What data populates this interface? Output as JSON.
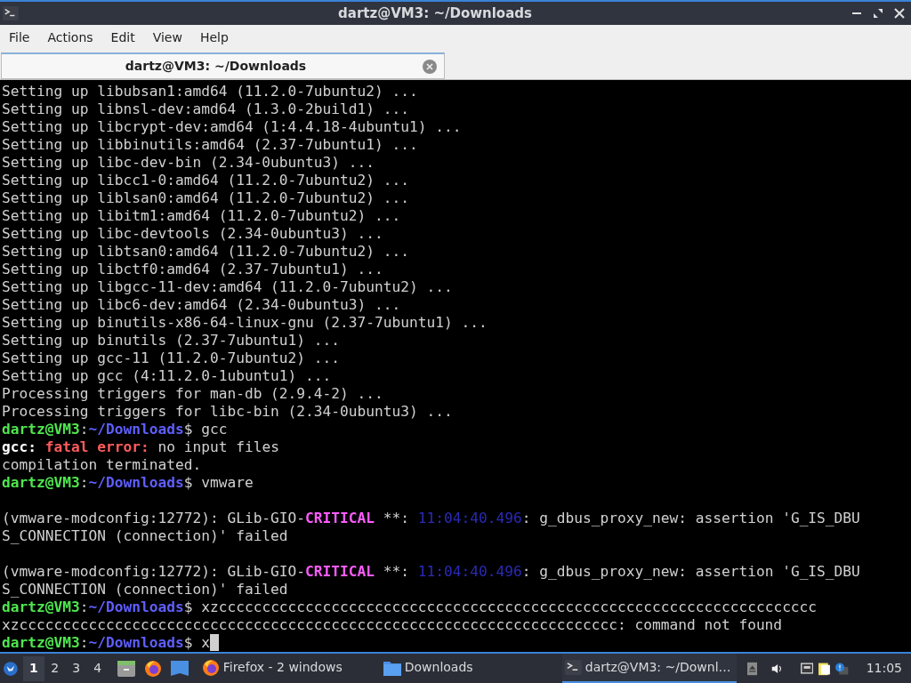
{
  "window": {
    "title": "dartz@VM3: ~/Downloads"
  },
  "menu": [
    "File",
    "Actions",
    "Edit",
    "View",
    "Help"
  ],
  "tabs": [
    {
      "label": "dartz@VM3: ~/Downloads",
      "selected": true
    }
  ],
  "terminal": {
    "lines": [
      {
        "kind": "text",
        "segments": [
          {
            "kind": "plain",
            "text": "Setting up libubsan1:amd64 (11.2.0-7ubuntu2) ..."
          }
        ]
      },
      {
        "kind": "text",
        "segments": [
          {
            "kind": "plain",
            "text": "Setting up libnsl-dev:amd64 (1.3.0-2build1) ..."
          }
        ]
      },
      {
        "kind": "text",
        "segments": [
          {
            "kind": "plain",
            "text": "Setting up libcrypt-dev:amd64 (1:4.4.18-4ubuntu1) ..."
          }
        ]
      },
      {
        "kind": "text",
        "segments": [
          {
            "kind": "plain",
            "text": "Setting up libbinutils:amd64 (2.37-7ubuntu1) ..."
          }
        ]
      },
      {
        "kind": "text",
        "segments": [
          {
            "kind": "plain",
            "text": "Setting up libc-dev-bin (2.34-0ubuntu3) ..."
          }
        ]
      },
      {
        "kind": "text",
        "segments": [
          {
            "kind": "plain",
            "text": "Setting up libcc1-0:amd64 (11.2.0-7ubuntu2) ..."
          }
        ]
      },
      {
        "kind": "text",
        "segments": [
          {
            "kind": "plain",
            "text": "Setting up liblsan0:amd64 (11.2.0-7ubuntu2) ..."
          }
        ]
      },
      {
        "kind": "text",
        "segments": [
          {
            "kind": "plain",
            "text": "Setting up libitm1:amd64 (11.2.0-7ubuntu2) ..."
          }
        ]
      },
      {
        "kind": "text",
        "segments": [
          {
            "kind": "plain",
            "text": "Setting up libc-devtools (2.34-0ubuntu3) ..."
          }
        ]
      },
      {
        "kind": "text",
        "segments": [
          {
            "kind": "plain",
            "text": "Setting up libtsan0:amd64 (11.2.0-7ubuntu2) ..."
          }
        ]
      },
      {
        "kind": "text",
        "segments": [
          {
            "kind": "plain",
            "text": "Setting up libctf0:amd64 (2.37-7ubuntu1) ..."
          }
        ]
      },
      {
        "kind": "text",
        "segments": [
          {
            "kind": "plain",
            "text": "Setting up libgcc-11-dev:amd64 (11.2.0-7ubuntu2) ..."
          }
        ]
      },
      {
        "kind": "text",
        "segments": [
          {
            "kind": "plain",
            "text": "Setting up libc6-dev:amd64 (2.34-0ubuntu3) ..."
          }
        ]
      },
      {
        "kind": "text",
        "segments": [
          {
            "kind": "plain",
            "text": "Setting up binutils-x86-64-linux-gnu (2.37-7ubuntu1) ..."
          }
        ]
      },
      {
        "kind": "text",
        "segments": [
          {
            "kind": "plain",
            "text": "Setting up binutils (2.37-7ubuntu1) ..."
          }
        ]
      },
      {
        "kind": "text",
        "segments": [
          {
            "kind": "plain",
            "text": "Setting up gcc-11 (11.2.0-7ubuntu2) ..."
          }
        ]
      },
      {
        "kind": "text",
        "segments": [
          {
            "kind": "plain",
            "text": "Setting up gcc (4:11.2.0-1ubuntu1) ..."
          }
        ]
      },
      {
        "kind": "text",
        "segments": [
          {
            "kind": "plain",
            "text": "Processing triggers for man-db (2.9.4-2) ..."
          }
        ]
      },
      {
        "kind": "text",
        "segments": [
          {
            "kind": "plain",
            "text": "Processing triggers for libc-bin (2.34-0ubuntu3) ..."
          }
        ]
      },
      {
        "kind": "text",
        "segments": [
          {
            "kind": "user",
            "text": "dartz@VM3"
          },
          {
            "kind": "plain",
            "text": ":"
          },
          {
            "kind": "path",
            "text": "~/Downloads"
          },
          {
            "kind": "plain",
            "text": "$ gcc"
          }
        ]
      },
      {
        "kind": "text",
        "segments": [
          {
            "kind": "bold",
            "text": "gcc:"
          },
          {
            "kind": "error",
            "text": " fatal error:"
          },
          {
            "kind": "plain",
            "text": " no input files"
          }
        ]
      },
      {
        "kind": "text",
        "segments": [
          {
            "kind": "plain",
            "text": "compilation terminated."
          }
        ]
      },
      {
        "kind": "text",
        "segments": [
          {
            "kind": "user",
            "text": "dartz@VM3"
          },
          {
            "kind": "plain",
            "text": ":"
          },
          {
            "kind": "path",
            "text": "~/Downloads"
          },
          {
            "kind": "plain",
            "text": "$ vmware"
          }
        ]
      },
      {
        "kind": "blank"
      },
      {
        "kind": "text",
        "segments": [
          {
            "kind": "plain",
            "text": "(vmware-modconfig:12772): GLib-GIO-"
          },
          {
            "kind": "critical",
            "text": "CRITICAL"
          },
          {
            "kind": "plain",
            "text": " **: "
          },
          {
            "kind": "time",
            "text": "11:04:40.496"
          },
          {
            "kind": "plain",
            "text": ": g_dbus_proxy_new: assertion 'G_IS_DBU"
          }
        ]
      },
      {
        "kind": "text",
        "segments": [
          {
            "kind": "plain",
            "text": "S_CONNECTION (connection)' failed"
          }
        ]
      },
      {
        "kind": "blank"
      },
      {
        "kind": "text",
        "segments": [
          {
            "kind": "plain",
            "text": "(vmware-modconfig:12772): GLib-GIO-"
          },
          {
            "kind": "critical",
            "text": "CRITICAL"
          },
          {
            "kind": "plain",
            "text": " **: "
          },
          {
            "kind": "time",
            "text": "11:04:40.496"
          },
          {
            "kind": "plain",
            "text": ": g_dbus_proxy_new: assertion 'G_IS_DBU"
          }
        ]
      },
      {
        "kind": "text",
        "segments": [
          {
            "kind": "plain",
            "text": "S_CONNECTION (connection)' failed"
          }
        ]
      },
      {
        "kind": "text",
        "segments": [
          {
            "kind": "user",
            "text": "dartz@VM3"
          },
          {
            "kind": "plain",
            "text": ":"
          },
          {
            "kind": "path",
            "text": "~/Downloads"
          },
          {
            "kind": "plain",
            "text": "$ xzccccccccccccccccccccccccccccccccccccccccccccccccccccccccccccccccccccc"
          }
        ]
      },
      {
        "kind": "text",
        "segments": [
          {
            "kind": "plain",
            "text": "xzccccccccccccccccccccccccccccccccccccccccccccccccccccccccccccccccccccc: command not found"
          }
        ]
      },
      {
        "kind": "text",
        "cursor": true,
        "segments": [
          {
            "kind": "user",
            "text": "dartz@VM3"
          },
          {
            "kind": "plain",
            "text": ":"
          },
          {
            "kind": "path",
            "text": "~/Downloads"
          },
          {
            "kind": "plain",
            "text": "$ x"
          }
        ]
      }
    ]
  },
  "taskbar": {
    "workspaces": [
      {
        "label": "1",
        "selected": true
      },
      {
        "label": "2",
        "selected": false
      },
      {
        "label": "3",
        "selected": false
      },
      {
        "label": "4",
        "selected": false
      }
    ],
    "launchers": [
      {
        "kind": "files"
      },
      {
        "kind": "firefox"
      },
      {
        "kind": "desktop"
      }
    ],
    "tasks": [
      {
        "kind": "firefox",
        "label": "Firefox - 2 windows",
        "selected": false
      },
      {
        "kind": "folder",
        "label": "Downloads",
        "selected": false
      },
      {
        "kind": "terminal",
        "label": "dartz@VM3: ~/Downl…",
        "selected": true
      }
    ],
    "clock": "11:05"
  }
}
